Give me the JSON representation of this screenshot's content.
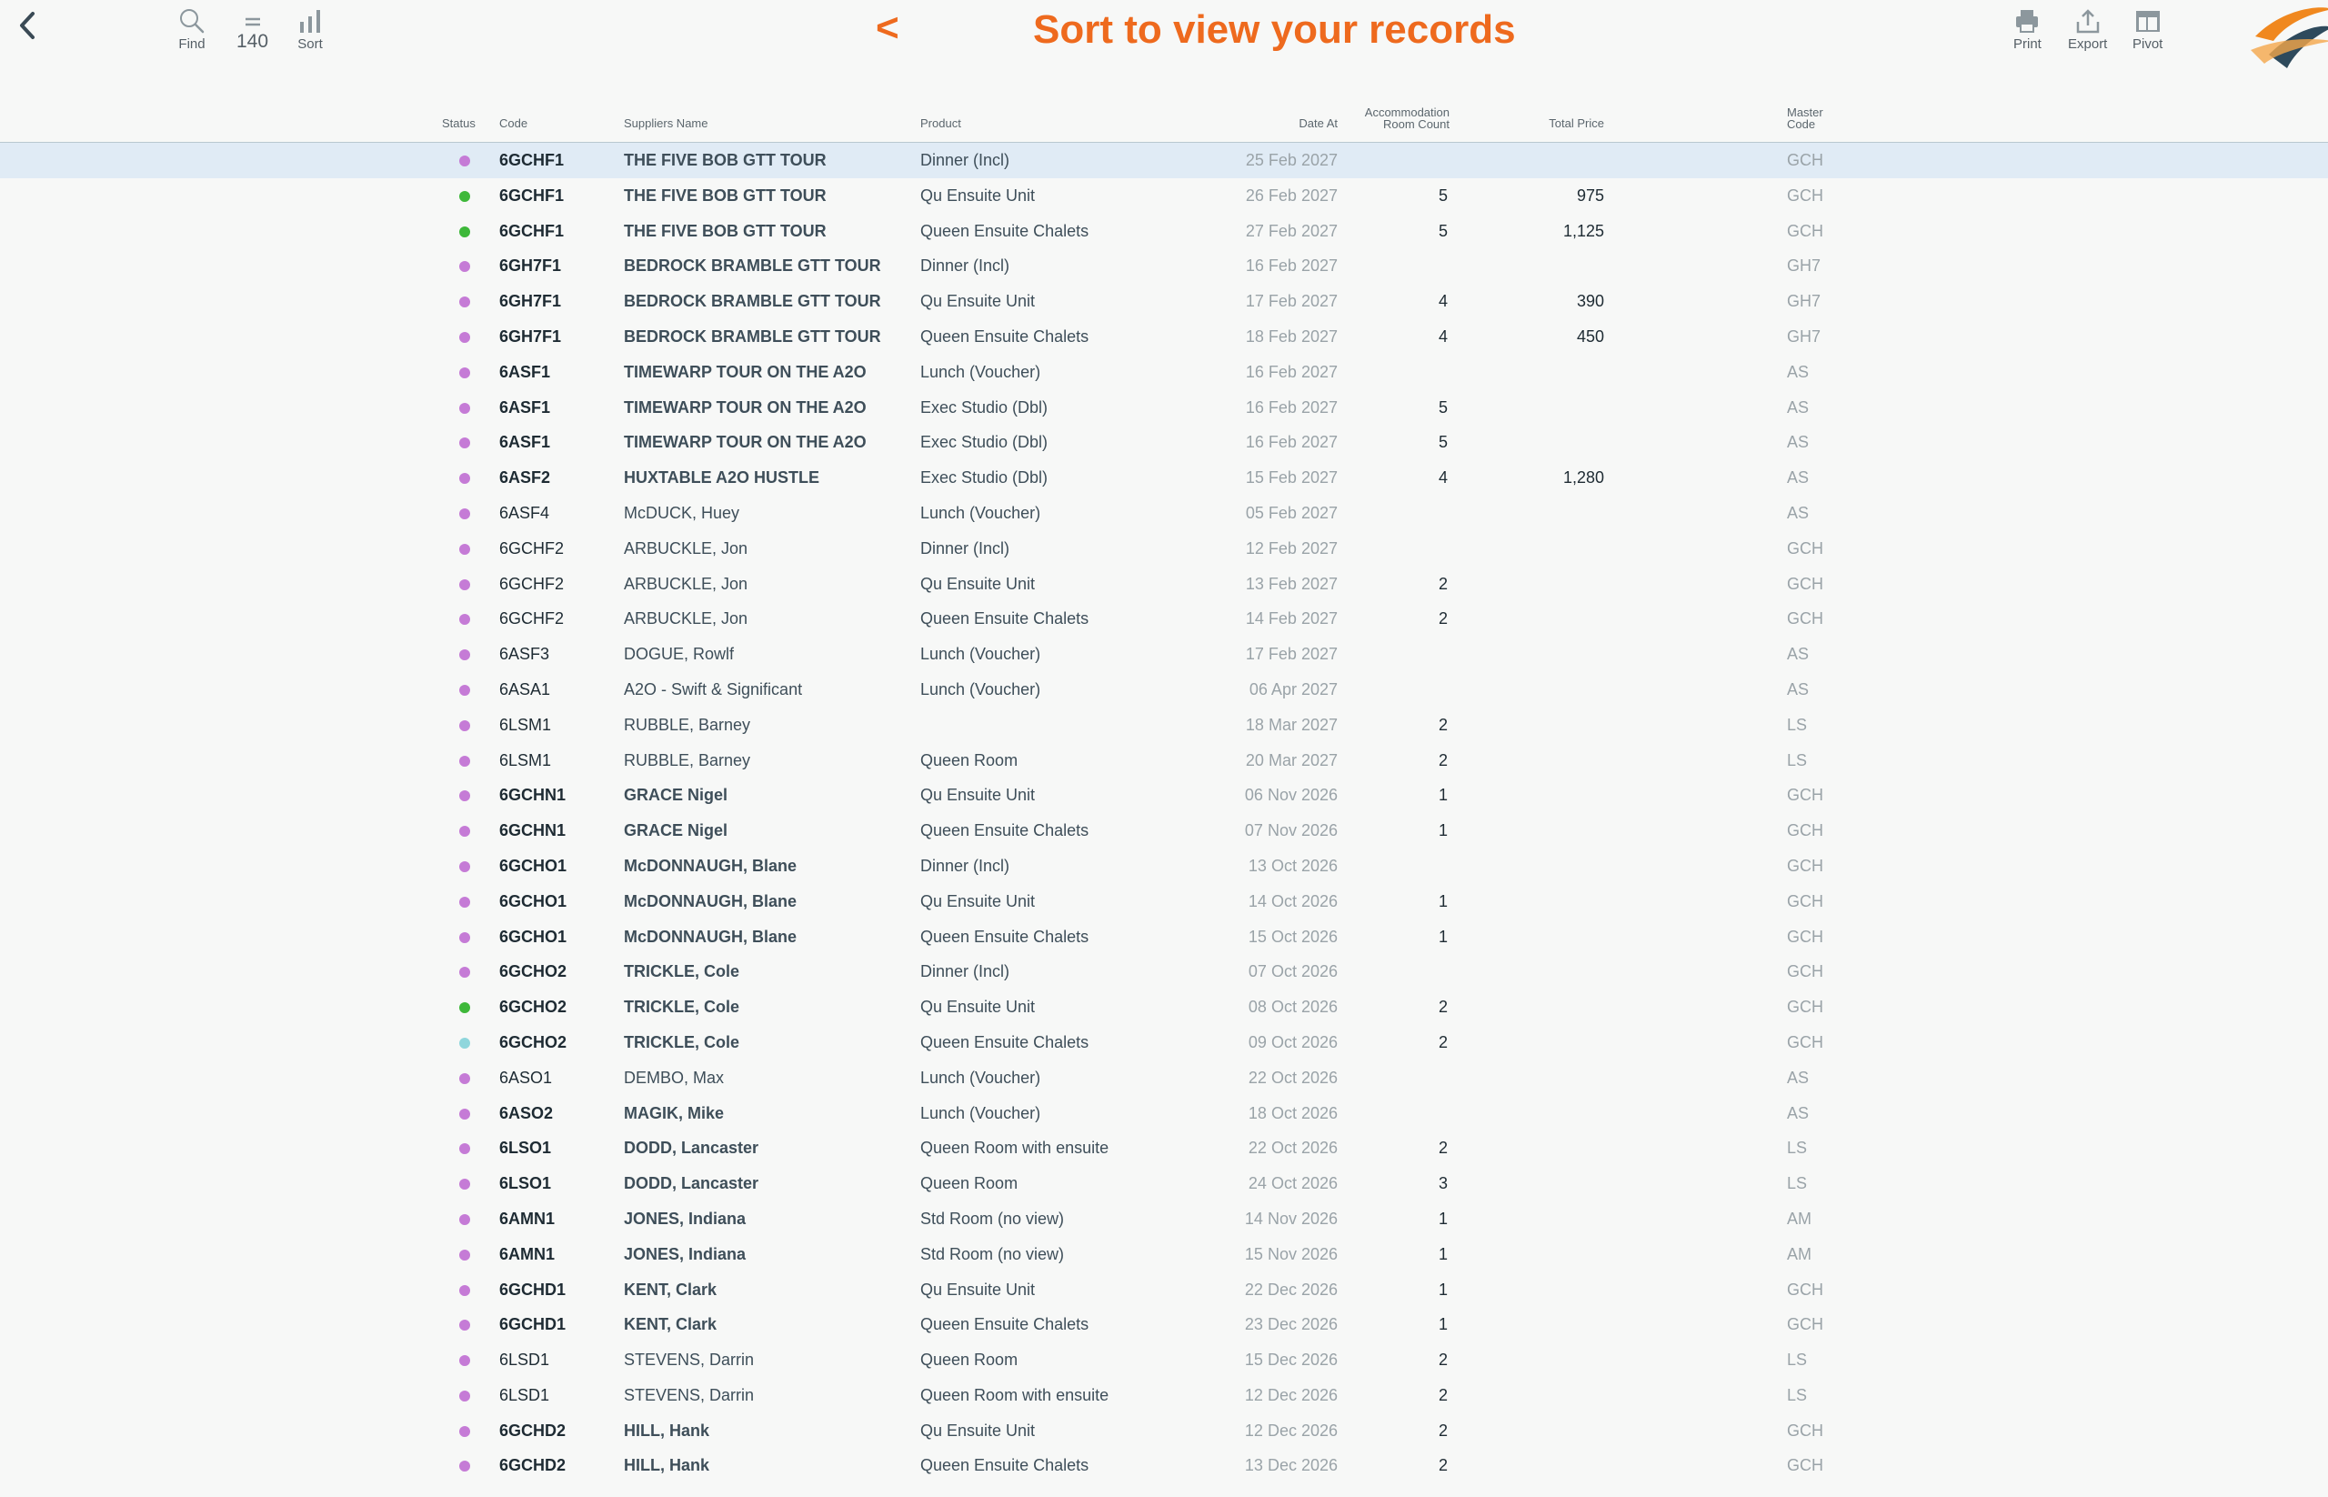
{
  "toolbar": {
    "find_label": "Find",
    "count_value": "140",
    "sort_label": "Sort",
    "title_arrow": "<",
    "title": "Sort to view your records",
    "print_label": "Print",
    "export_label": "Export",
    "pivot_label": "Pivot"
  },
  "colors": {
    "accent": "#ee6a1e",
    "status_purple": "#c57bd6",
    "status_green": "#3eb83a",
    "status_teal": "#8fd6dc",
    "selected_row": "#e0ebf5"
  },
  "columns": {
    "status": "Status",
    "code": "Code",
    "supplier": "Suppliers Name",
    "product": "Product",
    "date": "Date At",
    "acc_line1": "Accommodation",
    "acc_line2": "Room Count",
    "price": "Total Price",
    "master_line1": "Master",
    "master_line2": "Code"
  },
  "rows": [
    {
      "status": "purple",
      "code": "6GCHF1",
      "supplier": "THE FIVE BOB GTT TOUR",
      "product": "Dinner (Incl)",
      "date": "25 Feb 2027",
      "rooms": "",
      "price": "",
      "master": "GCH",
      "bold": true
    },
    {
      "status": "green",
      "code": "6GCHF1",
      "supplier": "THE FIVE BOB GTT TOUR",
      "product": "Qu Ensuite Unit",
      "date": "26 Feb 2027",
      "rooms": "5",
      "price": "975",
      "master": "GCH",
      "bold": true
    },
    {
      "status": "green",
      "code": "6GCHF1",
      "supplier": "THE FIVE BOB GTT TOUR",
      "product": "Queen Ensuite Chalets",
      "date": "27 Feb 2027",
      "rooms": "5",
      "price": "1,125",
      "master": "GCH",
      "bold": true
    },
    {
      "status": "purple",
      "code": "6GH7F1",
      "supplier": "BEDROCK BRAMBLE GTT TOUR",
      "product": "Dinner (Incl)",
      "date": "16 Feb 2027",
      "rooms": "",
      "price": "",
      "master": "GH7",
      "bold": true
    },
    {
      "status": "purple",
      "code": "6GH7F1",
      "supplier": "BEDROCK BRAMBLE GTT TOUR",
      "product": "Qu Ensuite Unit",
      "date": "17 Feb 2027",
      "rooms": "4",
      "price": "390",
      "master": "GH7",
      "bold": true
    },
    {
      "status": "purple",
      "code": "6GH7F1",
      "supplier": "BEDROCK BRAMBLE GTT TOUR",
      "product": "Queen Ensuite Chalets",
      "date": "18 Feb 2027",
      "rooms": "4",
      "price": "450",
      "master": "GH7",
      "bold": true
    },
    {
      "status": "purple",
      "code": "6ASF1",
      "supplier": "TIMEWARP TOUR ON THE A2O",
      "product": "Lunch (Voucher)",
      "date": "16 Feb 2027",
      "rooms": "",
      "price": "",
      "master": "AS",
      "bold": true
    },
    {
      "status": "purple",
      "code": "6ASF1",
      "supplier": "TIMEWARP TOUR ON THE A2O",
      "product": "Exec Studio (Dbl)",
      "date": "16 Feb 2027",
      "rooms": "5",
      "price": "",
      "master": "AS",
      "bold": true
    },
    {
      "status": "purple",
      "code": "6ASF1",
      "supplier": "TIMEWARP TOUR ON THE A2O",
      "product": "Exec Studio (Dbl)",
      "date": "16 Feb 2027",
      "rooms": "5",
      "price": "",
      "master": "AS",
      "bold": true
    },
    {
      "status": "purple",
      "code": "6ASF2",
      "supplier": "HUXTABLE A2O HUSTLE",
      "product": "Exec Studio (Dbl)",
      "date": "15 Feb 2027",
      "rooms": "4",
      "price": "1,280",
      "master": "AS",
      "bold": true
    },
    {
      "status": "purple",
      "code": "6ASF4",
      "supplier": "McDUCK, Huey",
      "product": "Lunch (Voucher)",
      "date": "05 Feb 2027",
      "rooms": "",
      "price": "",
      "master": "AS",
      "bold": false
    },
    {
      "status": "purple",
      "code": "6GCHF2",
      "supplier": "ARBUCKLE, Jon",
      "product": "Dinner (Incl)",
      "date": "12 Feb 2027",
      "rooms": "",
      "price": "",
      "master": "GCH",
      "bold": false
    },
    {
      "status": "purple",
      "code": "6GCHF2",
      "supplier": "ARBUCKLE, Jon",
      "product": "Qu Ensuite Unit",
      "date": "13 Feb 2027",
      "rooms": "2",
      "price": "",
      "master": "GCH",
      "bold": false
    },
    {
      "status": "purple",
      "code": "6GCHF2",
      "supplier": "ARBUCKLE, Jon",
      "product": "Queen Ensuite Chalets",
      "date": "14 Feb 2027",
      "rooms": "2",
      "price": "",
      "master": "GCH",
      "bold": false
    },
    {
      "status": "purple",
      "code": "6ASF3",
      "supplier": "DOGUE, Rowlf",
      "product": "Lunch (Voucher)",
      "date": "17 Feb 2027",
      "rooms": "",
      "price": "",
      "master": "AS",
      "bold": false
    },
    {
      "status": "purple",
      "code": "6ASA1",
      "supplier": "A2O - Swift & Significant",
      "product": "Lunch (Voucher)",
      "date": "06 Apr 2027",
      "rooms": "",
      "price": "",
      "master": "AS",
      "bold": false
    },
    {
      "status": "purple",
      "code": "6LSM1",
      "supplier": "RUBBLE, Barney",
      "product": "",
      "date": "18 Mar 2027",
      "rooms": "2",
      "price": "",
      "master": "LS",
      "bold": false
    },
    {
      "status": "purple",
      "code": "6LSM1",
      "supplier": "RUBBLE, Barney",
      "product": "Queen Room",
      "date": "20 Mar 2027",
      "rooms": "2",
      "price": "",
      "master": "LS",
      "bold": false
    },
    {
      "status": "purple",
      "code": "6GCHN1",
      "supplier": "GRACE Nigel",
      "product": "Qu Ensuite Unit",
      "date": "06 Nov 2026",
      "rooms": "1",
      "price": "",
      "master": "GCH",
      "bold": true
    },
    {
      "status": "purple",
      "code": "6GCHN1",
      "supplier": "GRACE Nigel",
      "product": "Queen Ensuite Chalets",
      "date": "07 Nov 2026",
      "rooms": "1",
      "price": "",
      "master": "GCH",
      "bold": true
    },
    {
      "status": "purple",
      "code": "6GCHO1",
      "supplier": "McDONNAUGH, Blane",
      "product": "Dinner (Incl)",
      "date": "13 Oct 2026",
      "rooms": "",
      "price": "",
      "master": "GCH",
      "bold": true
    },
    {
      "status": "purple",
      "code": "6GCHO1",
      "supplier": "McDONNAUGH, Blane",
      "product": "Qu Ensuite Unit",
      "date": "14 Oct 2026",
      "rooms": "1",
      "price": "",
      "master": "GCH",
      "bold": true
    },
    {
      "status": "purple",
      "code": "6GCHO1",
      "supplier": "McDONNAUGH, Blane",
      "product": "Queen Ensuite Chalets",
      "date": "15 Oct 2026",
      "rooms": "1",
      "price": "",
      "master": "GCH",
      "bold": true
    },
    {
      "status": "purple",
      "code": "6GCHO2",
      "supplier": "TRICKLE, Cole",
      "product": "Dinner (Incl)",
      "date": "07 Oct 2026",
      "rooms": "",
      "price": "",
      "master": "GCH",
      "bold": true
    },
    {
      "status": "green",
      "code": "6GCHO2",
      "supplier": "TRICKLE, Cole",
      "product": "Qu Ensuite Unit",
      "date": "08 Oct 2026",
      "rooms": "2",
      "price": "",
      "master": "GCH",
      "bold": true
    },
    {
      "status": "teal",
      "code": "6GCHO2",
      "supplier": "TRICKLE, Cole",
      "product": "Queen Ensuite Chalets",
      "date": "09 Oct 2026",
      "rooms": "2",
      "price": "",
      "master": "GCH",
      "bold": true
    },
    {
      "status": "purple",
      "code": "6ASO1",
      "supplier": "DEMBO, Max",
      "product": "Lunch (Voucher)",
      "date": "22 Oct 2026",
      "rooms": "",
      "price": "",
      "master": "AS",
      "bold": false
    },
    {
      "status": "purple",
      "code": "6ASO2",
      "supplier": "MAGIK, Mike",
      "product": "Lunch (Voucher)",
      "date": "18 Oct 2026",
      "rooms": "",
      "price": "",
      "master": "AS",
      "bold": true
    },
    {
      "status": "purple",
      "code": "6LSO1",
      "supplier": "DODD, Lancaster",
      "product": "Queen Room with ensuite",
      "date": "22 Oct 2026",
      "rooms": "2",
      "price": "",
      "master": "LS",
      "bold": true
    },
    {
      "status": "purple",
      "code": "6LSO1",
      "supplier": "DODD, Lancaster",
      "product": "Queen Room",
      "date": "24 Oct 2026",
      "rooms": "3",
      "price": "",
      "master": "LS",
      "bold": true
    },
    {
      "status": "purple",
      "code": "6AMN1",
      "supplier": "JONES, Indiana",
      "product": "Std Room (no view)",
      "date": "14 Nov 2026",
      "rooms": "1",
      "price": "",
      "master": "AM",
      "bold": true
    },
    {
      "status": "purple",
      "code": "6AMN1",
      "supplier": "JONES, Indiana",
      "product": "Std Room (no view)",
      "date": "15 Nov 2026",
      "rooms": "1",
      "price": "",
      "master": "AM",
      "bold": true
    },
    {
      "status": "purple",
      "code": "6GCHD1",
      "supplier": "KENT, Clark",
      "product": "Qu Ensuite Unit",
      "date": "22 Dec 2026",
      "rooms": "1",
      "price": "",
      "master": "GCH",
      "bold": true
    },
    {
      "status": "purple",
      "code": "6GCHD1",
      "supplier": "KENT, Clark",
      "product": "Queen Ensuite Chalets",
      "date": "23 Dec 2026",
      "rooms": "1",
      "price": "",
      "master": "GCH",
      "bold": true
    },
    {
      "status": "purple",
      "code": "6LSD1",
      "supplier": "STEVENS, Darrin",
      "product": "Queen Room",
      "date": "15 Dec 2026",
      "rooms": "2",
      "price": "",
      "master": "LS",
      "bold": false
    },
    {
      "status": "purple",
      "code": "6LSD1",
      "supplier": "STEVENS, Darrin",
      "product": "Queen Room with ensuite",
      "date": "12 Dec 2026",
      "rooms": "2",
      "price": "",
      "master": "LS",
      "bold": false
    },
    {
      "status": "purple",
      "code": "6GCHD2",
      "supplier": "HILL, Hank",
      "product": "Qu Ensuite Unit",
      "date": "12 Dec 2026",
      "rooms": "2",
      "price": "",
      "master": "GCH",
      "bold": true
    },
    {
      "status": "purple",
      "code": "6GCHD2",
      "supplier": "HILL, Hank",
      "product": "Queen Ensuite Chalets",
      "date": "13 Dec 2026",
      "rooms": "2",
      "price": "",
      "master": "GCH",
      "bold": true
    }
  ]
}
